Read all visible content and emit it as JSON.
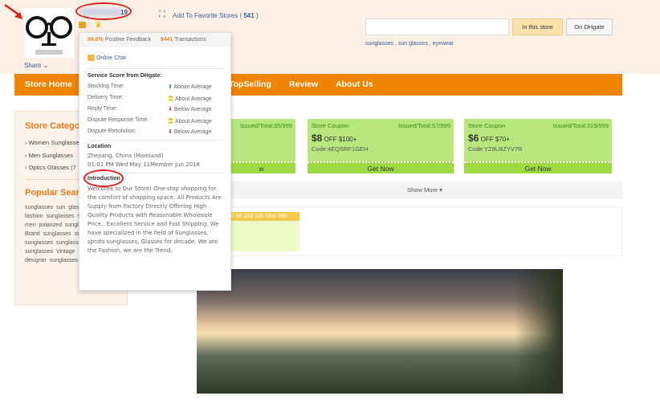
{
  "store": {
    "name_suffix": "19",
    "favorite_label": "Add To Favorite Stores (",
    "favorite_count": "541",
    "favorite_close": ")",
    "share": "Share"
  },
  "search": {
    "value": "",
    "in_store": "In this store",
    "on_dhgate": "On DHgate",
    "keywords": "sunglasses , sun glasses , eyewear"
  },
  "nav": {
    "items": [
      "Store Home",
      "TopSelling",
      "Review",
      "About Us"
    ]
  },
  "sidebar": {
    "categories_title": "Store Categories",
    "categories": [
      "Women Sunglasses",
      "Men Sunglasses",
      "Optics Glasses (7"
    ],
    "popular_title": "Popular Searches",
    "popular_text": "sunglasses sun glasses eyewear fashion sunglasses sunglasses women men polarized sunglasses sunglasses Brand sunglasses steampunk sunglasses sunglasses children sport sunglasses Vintage Sunglasses Brand designer sunglasses"
  },
  "popup": {
    "feedback_pct": "98.8%",
    "feedback_label": "Positive Feedback",
    "transactions": "9441",
    "transactions_label": "Transactions",
    "chat": "Online Chat",
    "score_title": "Service Score from DHgate:",
    "scores": [
      {
        "label": "Stocking Time:",
        "value": "Above Average",
        "icon": "arrow-up",
        "color": "#3aa83a"
      },
      {
        "label": "Delivery Time:",
        "value": "About Average",
        "icon": "equals",
        "color": "#f5b800"
      },
      {
        "label": "Reply Time:",
        "value": "Below Average",
        "icon": "arrow-down",
        "color": "#e34040"
      },
      {
        "label": "Dispute Response Time:",
        "value": "About Average",
        "icon": "equals",
        "color": "#f5b800"
      },
      {
        "label": "Dispute Resolution:",
        "value": "Below Average",
        "icon": "arrow-down",
        "color": "#e34040"
      }
    ],
    "location_title": "Location",
    "location": "Zhejiang, China (Mainland)",
    "time_member": "01:01 PM Wed May 11Member Jun 2018",
    "intro_title": "Introduction",
    "intro": "Welcome to Our Store! One-stop shopping for the comfort of shopping space. All Products Are Supply from Factory Directly Offering High Quality Products with Reasonable Wholesale Price.. Excellent Service and Fast Shipping. We have specialized in the field of Sunglasses, sprots sunglasses, Glasses for decade. We are the Fashion, we are the Trend."
  },
  "coupons": [
    {
      "title": "",
      "issued": "Issued/Total:35/999",
      "amount": "",
      "off": "",
      "code": "",
      "button": "w"
    },
    {
      "title": "Store Coupon",
      "issued": "Issued/Total:57/999",
      "amount": "$8",
      "off": "OFF $100+",
      "code": "Code:4EQSRF1GEH",
      "button": "Get Now"
    },
    {
      "title": "Store Coupon",
      "issued": "Issued/Total:319/999",
      "amount": "$6",
      "off": "OFF $70+",
      "code": "Code:YZ8U8ZYV7R",
      "button": "Get Now"
    }
  ],
  "show_more": "Show More",
  "flash": {
    "timer": "id for 20d 10h 55m 59s"
  },
  "colors": {
    "accent": "#f08300",
    "coupon": "#b7e77e",
    "header_bg": "#fcefe3"
  }
}
